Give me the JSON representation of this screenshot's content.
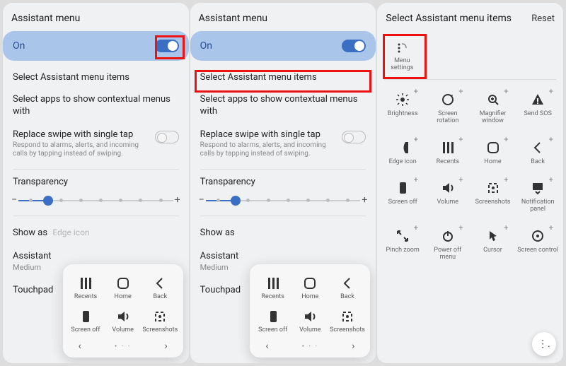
{
  "s1": {
    "header": "Assistant menu",
    "toggle_label": "On",
    "select_items": "Select Assistant menu items",
    "select_apps": "Select apps to show contextual menus with",
    "replace_title": "Replace swipe with single tap",
    "replace_sub": "Respond to alarms, alerts, and incoming calls by tapping instead of swiping.",
    "transparency": "Transparency",
    "slider_value_pct": 0.18,
    "show_as": "Show as",
    "show_as_ghost": "Edge icon",
    "assistant_size": "Assistant",
    "assistant_size_val": "Medium",
    "touchpad": "Touchpad",
    "popup": {
      "items": [
        {
          "label": "Recents",
          "icon": "recents-icon"
        },
        {
          "label": "Home",
          "icon": "home-icon"
        },
        {
          "label": "Back",
          "icon": "back-icon"
        },
        {
          "label": "Screen off",
          "icon": "screenoff-icon"
        },
        {
          "label": "Volume",
          "icon": "volume-icon"
        },
        {
          "label": "Screenshots",
          "icon": "screenshot-icon"
        }
      ]
    }
  },
  "s2": {
    "header": "Assistant menu",
    "toggle_label": "On",
    "select_items": "Select Assistant menu items",
    "select_apps": "Select apps to show contextual menus with",
    "replace_title": "Replace swipe with single tap",
    "replace_sub": "Respond to alarms, alerts, and incoming calls by tapping instead of swiping.",
    "transparency": "Transparency",
    "slider_value_pct": 0.18,
    "show_as": "Show as",
    "assistant_size": "Assistant",
    "assistant_size_val": "Medium",
    "touchpad": "Touchpad",
    "popup": {
      "items": [
        {
          "label": "Recents",
          "icon": "recents-icon"
        },
        {
          "label": "Home",
          "icon": "home-icon"
        },
        {
          "label": "Back",
          "icon": "back-icon"
        },
        {
          "label": "Screen off",
          "icon": "screenoff-icon"
        },
        {
          "label": "Volume",
          "icon": "volume-icon"
        },
        {
          "label": "Screenshots",
          "icon": "screenshot-icon"
        }
      ]
    }
  },
  "s3": {
    "header": "Select Assistant menu items",
    "reset": "Reset",
    "top_item": {
      "label": "Menu settings",
      "icon": "menusettings-icon"
    },
    "grid": [
      {
        "label": "Brightness",
        "icon": "brightness-icon"
      },
      {
        "label": "Screen rotation",
        "icon": "rotation-icon"
      },
      {
        "label": "Magnifier window",
        "icon": "magnifier-icon"
      },
      {
        "label": "Send SOS",
        "icon": "sos-icon"
      },
      {
        "label": "Edge icon",
        "icon": "edge-icon"
      },
      {
        "label": "Recents",
        "icon": "recents-icon"
      },
      {
        "label": "Home",
        "icon": "home-icon"
      },
      {
        "label": "Back",
        "icon": "back-icon"
      },
      {
        "label": "Screen off",
        "icon": "screenoff-icon"
      },
      {
        "label": "Volume",
        "icon": "volume-icon"
      },
      {
        "label": "Screenshots",
        "icon": "screenshot-icon"
      },
      {
        "label": "Notification panel",
        "icon": "notif-icon"
      },
      {
        "label": "Pinch zoom",
        "icon": "pinch-icon"
      },
      {
        "label": "Power off menu",
        "icon": "power-icon"
      },
      {
        "label": "Cursor",
        "icon": "cursor-icon"
      },
      {
        "label": "Screen control",
        "icon": "screenctrl-icon"
      }
    ]
  }
}
